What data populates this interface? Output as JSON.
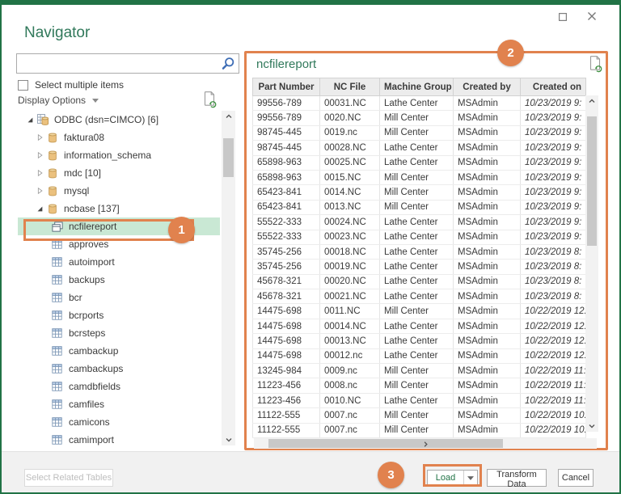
{
  "window": {
    "title": "Navigator"
  },
  "search": {
    "value": "",
    "placeholder": ""
  },
  "left_pane": {
    "select_multiple_label": "Select multiple items",
    "display_options_label": "Display Options",
    "tree": [
      {
        "label": "ODBC (dsn=CIMCO) [6]",
        "level": 0,
        "icon": "odbc-icon",
        "expander": "expanded"
      },
      {
        "label": "faktura08",
        "level": 1,
        "icon": "database-icon",
        "expander": "collapsed"
      },
      {
        "label": "information_schema",
        "level": 1,
        "icon": "database-icon",
        "expander": "collapsed"
      },
      {
        "label": "mdc [10]",
        "level": 1,
        "icon": "database-icon",
        "expander": "collapsed"
      },
      {
        "label": "mysql",
        "level": 1,
        "icon": "database-icon",
        "expander": "collapsed"
      },
      {
        "label": "ncbase [137]",
        "level": 1,
        "icon": "database-icon",
        "expander": "expanded"
      },
      {
        "label": "ncfilereport",
        "level": 2,
        "icon": "view-icon",
        "expander": "none",
        "selected": true
      },
      {
        "label": "approves",
        "level": 2,
        "icon": "table-icon",
        "expander": "none"
      },
      {
        "label": "autoimport",
        "level": 2,
        "icon": "table-icon",
        "expander": "none"
      },
      {
        "label": "backups",
        "level": 2,
        "icon": "table-icon",
        "expander": "none"
      },
      {
        "label": "bcr",
        "level": 2,
        "icon": "table-icon",
        "expander": "none"
      },
      {
        "label": "bcrports",
        "level": 2,
        "icon": "table-icon",
        "expander": "none"
      },
      {
        "label": "bcrsteps",
        "level": 2,
        "icon": "table-icon",
        "expander": "none"
      },
      {
        "label": "cambackup",
        "level": 2,
        "icon": "table-icon",
        "expander": "none"
      },
      {
        "label": "cambackups",
        "level": 2,
        "icon": "table-icon",
        "expander": "none"
      },
      {
        "label": "camdbfields",
        "level": 2,
        "icon": "table-icon",
        "expander": "none"
      },
      {
        "label": "camfiles",
        "level": 2,
        "icon": "table-icon",
        "expander": "none"
      },
      {
        "label": "camicons",
        "level": 2,
        "icon": "table-icon",
        "expander": "none"
      },
      {
        "label": "camimport",
        "level": 2,
        "icon": "table-icon",
        "expander": "none"
      }
    ]
  },
  "preview": {
    "title": "ncfilereport",
    "columns": [
      "Part Number",
      "NC File",
      "Machine Group",
      "Created by",
      "Created on"
    ],
    "rows": [
      [
        "99556-789",
        "00031.NC",
        "Lathe Center",
        "MSAdmin",
        "10/23/2019 9:"
      ],
      [
        "99556-789",
        "0020.NC",
        "Mill Center",
        "MSAdmin",
        "10/23/2019 9:"
      ],
      [
        "98745-445",
        "0019.nc",
        "Mill Center",
        "MSAdmin",
        "10/23/2019 9:"
      ],
      [
        "98745-445",
        "00028.NC",
        "Lathe Center",
        "MSAdmin",
        "10/23/2019 9:"
      ],
      [
        "65898-963",
        "00025.NC",
        "Lathe Center",
        "MSAdmin",
        "10/23/2019 9:"
      ],
      [
        "65898-963",
        "0015.NC",
        "Mill Center",
        "MSAdmin",
        "10/23/2019 9:"
      ],
      [
        "65423-841",
        "0014.NC",
        "Mill Center",
        "MSAdmin",
        "10/23/2019 9:"
      ],
      [
        "65423-841",
        "0013.NC",
        "Mill Center",
        "MSAdmin",
        "10/23/2019 9:"
      ],
      [
        "55522-333",
        "00024.NC",
        "Lathe Center",
        "MSAdmin",
        "10/23/2019 9:"
      ],
      [
        "55522-333",
        "00023.NC",
        "Lathe Center",
        "MSAdmin",
        "10/23/2019 9:"
      ],
      [
        "35745-256",
        "00018.NC",
        "Lathe Center",
        "MSAdmin",
        "10/23/2019 8:"
      ],
      [
        "35745-256",
        "00019.NC",
        "Lathe Center",
        "MSAdmin",
        "10/23/2019 8:"
      ],
      [
        "45678-321",
        "00020.NC",
        "Lathe Center",
        "MSAdmin",
        "10/23/2019 8:"
      ],
      [
        "45678-321",
        "00021.NC",
        "Lathe Center",
        "MSAdmin",
        "10/23/2019 8:"
      ],
      [
        "14475-698",
        "0011.NC",
        "Mill Center",
        "MSAdmin",
        "10/22/2019 12:"
      ],
      [
        "14475-698",
        "00014.NC",
        "Lathe Center",
        "MSAdmin",
        "10/22/2019 12:"
      ],
      [
        "14475-698",
        "00013.NC",
        "Lathe Center",
        "MSAdmin",
        "10/22/2019 12:"
      ],
      [
        "14475-698",
        "00012.nc",
        "Lathe Center",
        "MSAdmin",
        "10/22/2019 12:"
      ],
      [
        "13245-984",
        "0009.nc",
        "Mill Center",
        "MSAdmin",
        "10/22/2019 11:"
      ],
      [
        "11223-456",
        "0008.nc",
        "Mill Center",
        "MSAdmin",
        "10/22/2019 11:"
      ],
      [
        "11223-456",
        "0010.NC",
        "Lathe Center",
        "MSAdmin",
        "10/22/2019 11:"
      ],
      [
        "11122-555",
        "0007.nc",
        "Mill Center",
        "MSAdmin",
        "10/22/2019 10:"
      ],
      [
        "11122-555",
        "0007.nc",
        "Mill Center",
        "MSAdmin",
        "10/22/2019 10:"
      ]
    ]
  },
  "footer": {
    "select_related_label": "Select Related Tables",
    "load_label": "Load",
    "transform_label": "Transform Data",
    "cancel_label": "Cancel"
  },
  "annotations": {
    "step1": "1",
    "step2": "2",
    "step3": "3"
  },
  "colors": {
    "accent_green": "#217346",
    "accent_orange": "#E1824E",
    "selection_green": "#C9E8D4"
  }
}
